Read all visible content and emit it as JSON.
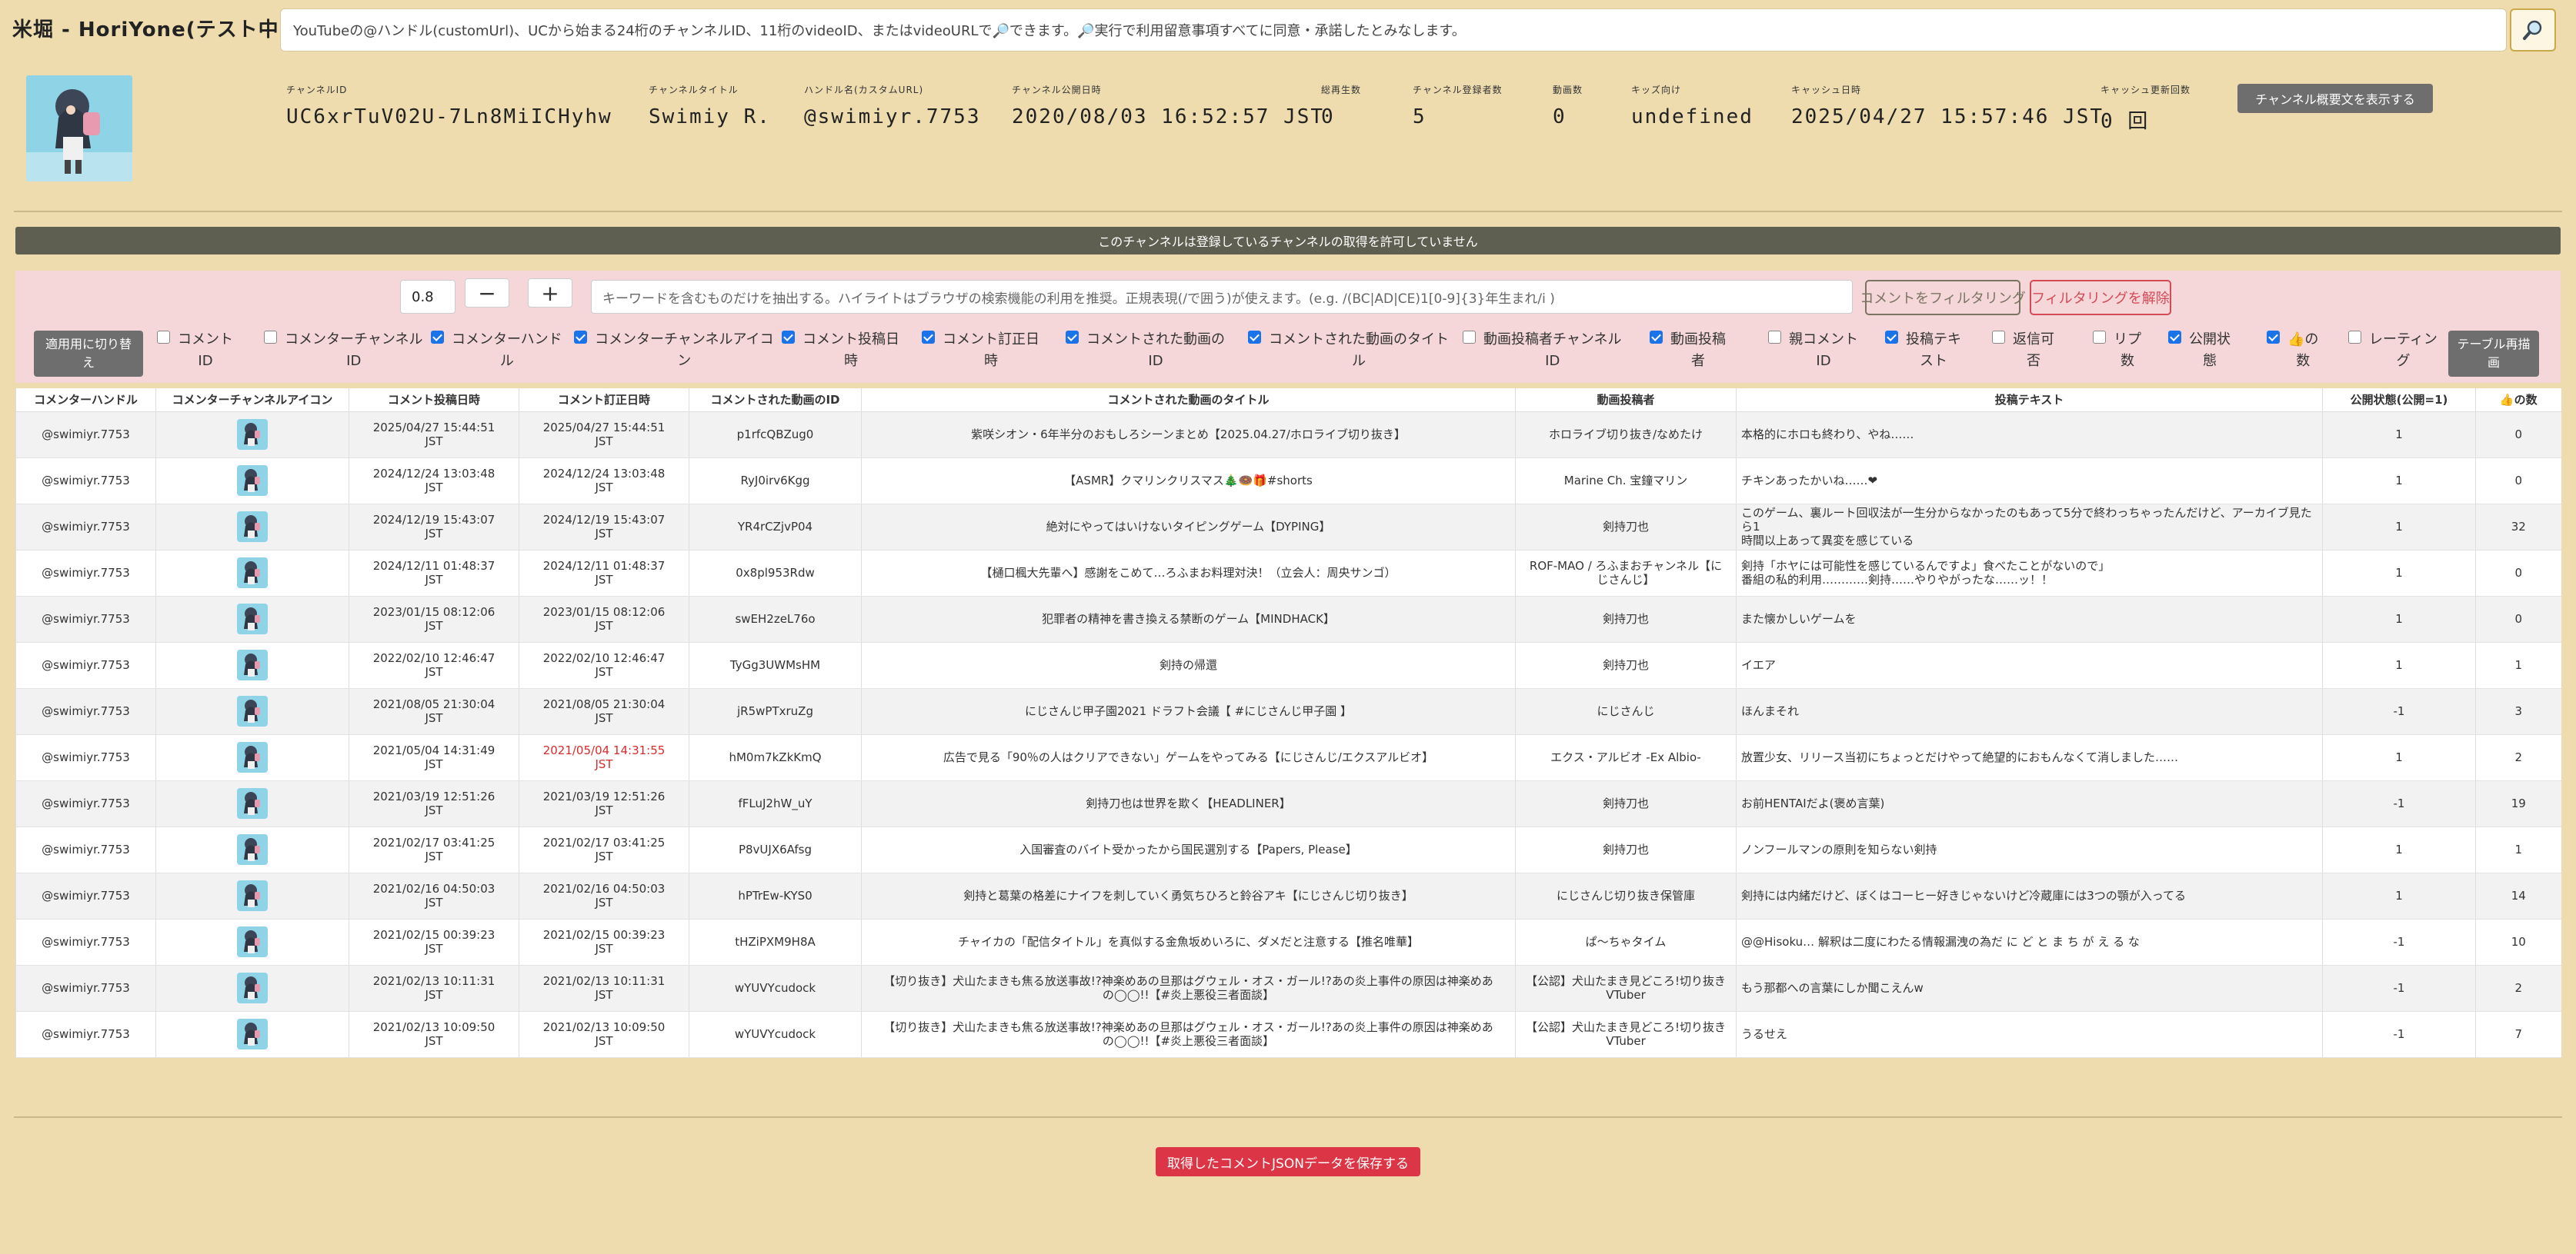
{
  "app": {
    "title": "米堀 - HoriYone(テスト中)"
  },
  "search": {
    "placeholder": "YouTubeの@ハンドル(customUrl)、UCから始まる24桁のチャンネルID、11桁のvideoID、またはvideoURLで🔎できます。🔎実行で利用留意事項すべてに同意・承諾したとみなします。",
    "button_icon": "search-icon"
  },
  "channel": {
    "fields": [
      {
        "label": "チャンネルID",
        "value": "UC6xrTuV02U-7Ln8MiICHyhw"
      },
      {
        "label": "チャンネルタイトル",
        "value": "Swimiy R."
      },
      {
        "label": "ハンドル名(カスタムURL)",
        "value": "@swimiyr.7753"
      },
      {
        "label": "チャンネル公開日時",
        "value": "2020/08/03 16:52:57 JST"
      },
      {
        "label": "総再生数",
        "value": "0"
      },
      {
        "label": "チャンネル登録者数",
        "value": "5"
      },
      {
        "label": "動画数",
        "value": "0"
      },
      {
        "label": "キッズ向け",
        "value": "undefined"
      },
      {
        "label": "キャッシュ日時",
        "value": "2025/04/27 15:57:46 JST"
      },
      {
        "label": "キャッシュ更新回数",
        "value": "0 回"
      }
    ],
    "desc_button": "チャンネル概要文を表示する"
  },
  "notice": "このチャンネルは登録しているチャンネルの取得を許可していません",
  "filter": {
    "zoom": "0.8",
    "minus_label": "−",
    "plus_label": "+",
    "keyword_placeholder": "キーワードを含むものだけを抽出する。ハイライトはブラウザの検索機能の利用を推奨。正規表現(/で囲う)が使えます。(e.g. /(BC|AD|CE)1[0-9]{3}年生まれ/i )",
    "filter_button": "コメントをフィルタリング",
    "clear_button": "フィルタリングを解除",
    "apply_toggle": [
      "適用用に切り替",
      "え"
    ],
    "redraw": [
      "テーブル再描",
      "画"
    ],
    "columns": [
      {
        "lines": [
          "コメント",
          "ID"
        ],
        "checked": false
      },
      {
        "lines": [
          "コメンターチャンネル",
          "ID"
        ],
        "checked": false
      },
      {
        "lines": [
          "コメンターハンド",
          "ル"
        ],
        "checked": true
      },
      {
        "lines": [
          "コメンターチャンネルアイコ",
          "ン"
        ],
        "checked": true
      },
      {
        "lines": [
          "コメント投稿日",
          "時"
        ],
        "checked": true
      },
      {
        "lines": [
          "コメント訂正日",
          "時"
        ],
        "checked": true
      },
      {
        "lines": [
          "コメントされた動画の",
          "ID"
        ],
        "checked": true
      },
      {
        "lines": [
          "コメントされた動画のタイト",
          "ル"
        ],
        "checked": true
      },
      {
        "lines": [
          "動画投稿者チャンネル",
          "ID"
        ],
        "checked": false
      },
      {
        "lines": [
          "動画投稿",
          "者"
        ],
        "checked": true
      },
      {
        "lines": [
          "親コメント",
          "ID"
        ],
        "checked": false
      },
      {
        "lines": [
          "投稿テキ",
          "スト"
        ],
        "checked": true
      },
      {
        "lines": [
          "返信可",
          "否"
        ],
        "checked": false
      },
      {
        "lines": [
          "リプ",
          "数"
        ],
        "checked": false
      },
      {
        "lines": [
          "公開状",
          "態"
        ],
        "checked": true
      },
      {
        "lines": [
          "👍の",
          "数"
        ],
        "checked": true
      },
      {
        "lines": [
          "レーティン",
          "グ"
        ],
        "checked": false
      }
    ]
  },
  "table": {
    "headers": [
      "コメンターハンドル",
      "コメンターチャンネルアイコン",
      "コメント投稿日時",
      "コメント訂正日時",
      "コメントされた動画のID",
      "コメントされた動画のタイトル",
      "動画投稿者",
      "投稿テキスト",
      "公開状態(公開=1)",
      "👍の数"
    ],
    "rows": [
      {
        "handle": "@swimiyr.7753",
        "posted": [
          "2025/04/27 15:44:51",
          "JST"
        ],
        "edited": [
          "2025/04/27 15:44:51",
          "JST"
        ],
        "edited_red": false,
        "video_id": "p1rfcQBZug0",
        "title": [
          "紫咲シオン・6年半分のおもしろシーンまとめ【2025.04.27/ホロライブ切り抜き】"
        ],
        "uploader": [
          "ホロライブ切り抜き/なめたけ"
        ],
        "text": [
          "本格的にホロも終わり、やね……"
        ],
        "public": "1",
        "likes": "0"
      },
      {
        "handle": "@swimiyr.7753",
        "posted": [
          "2024/12/24 13:03:48",
          "JST"
        ],
        "edited": [
          "2024/12/24 13:03:48",
          "JST"
        ],
        "edited_red": false,
        "video_id": "RyJ0irv6Kgg",
        "title": [
          "【ASMR】クマリンクリスマス🎄🍩🎁#shorts"
        ],
        "uploader": [
          "Marine Ch. 宝鐘マリン"
        ],
        "text": [
          "チキンあったかいね……❤"
        ],
        "public": "1",
        "likes": "0"
      },
      {
        "handle": "@swimiyr.7753",
        "posted": [
          "2024/12/19 15:43:07",
          "JST"
        ],
        "edited": [
          "2024/12/19 15:43:07",
          "JST"
        ],
        "edited_red": false,
        "video_id": "YR4rCZjvP04",
        "title": [
          "絶対にやってはいけないタイピングゲーム【DYPING】"
        ],
        "uploader": [
          "剣持刀也"
        ],
        "text": [
          "このゲーム、裏ルート回収法が一生分からなかったのもあって5分で終わっちゃったんだけど、アーカイブ見たら1",
          "時間以上あって異変を感じている"
        ],
        "public": "1",
        "likes": "32"
      },
      {
        "handle": "@swimiyr.7753",
        "posted": [
          "2024/12/11 01:48:37",
          "JST"
        ],
        "edited": [
          "2024/12/11 01:48:37",
          "JST"
        ],
        "edited_red": false,
        "video_id": "0x8pl953Rdw",
        "title": [
          "【樋口楓大先輩へ】感謝をこめて…ろふまお料理対決！（立会人：周央サンゴ）"
        ],
        "uploader": [
          "ROF-MAO / ろふまおチャンネル【に",
          "じさんじ】"
        ],
        "text": [
          "剣持「ホヤには可能性を感じているんですよ」食べたことがないので」",
          "番組の私的利用…………剣持……やりやがったな……ッ！！"
        ],
        "public": "1",
        "likes": "0"
      },
      {
        "handle": "@swimiyr.7753",
        "posted": [
          "2023/01/15 08:12:06",
          "JST"
        ],
        "edited": [
          "2023/01/15 08:12:06",
          "JST"
        ],
        "edited_red": false,
        "video_id": "swEH2zeL76o",
        "title": [
          "犯罪者の精神を書き換える禁断のゲーム【MINDHACK】"
        ],
        "uploader": [
          "剣持刀也"
        ],
        "text": [
          "また懐かしいゲームを"
        ],
        "public": "1",
        "likes": "0"
      },
      {
        "handle": "@swimiyr.7753",
        "posted": [
          "2022/02/10 12:46:47",
          "JST"
        ],
        "edited": [
          "2022/02/10 12:46:47",
          "JST"
        ],
        "edited_red": false,
        "video_id": "TyGg3UWMsHM",
        "title": [
          "剣持の帰還"
        ],
        "uploader": [
          "剣持刀也"
        ],
        "text": [
          "イエア"
        ],
        "public": "1",
        "likes": "1"
      },
      {
        "handle": "@swimiyr.7753",
        "posted": [
          "2021/08/05 21:30:04",
          "JST"
        ],
        "edited": [
          "2021/08/05 21:30:04",
          "JST"
        ],
        "edited_red": false,
        "video_id": "jR5wPTxruZg",
        "title": [
          "にじさんじ甲子園2021 ドラフト会議【 #にじさんじ甲子園 】"
        ],
        "uploader": [
          "にじさんじ"
        ],
        "text": [
          "ほんまそれ"
        ],
        "public": "-1",
        "likes": "3"
      },
      {
        "handle": "@swimiyr.7753",
        "posted": [
          "2021/05/04 14:31:49",
          "JST"
        ],
        "edited": [
          "2021/05/04 14:31:55",
          "JST"
        ],
        "edited_red": true,
        "video_id": "hM0m7kZkKmQ",
        "title": [
          "広告で見る「90％の人はクリアできない」ゲームをやってみる【にじさんじ/エクスアルビオ】"
        ],
        "uploader": [
          "エクス・アルビオ -Ex Albio-"
        ],
        "text": [
          "放置少女、リリース当初にちょっとだけやって絶望的におもんなくて消しました……"
        ],
        "public": "1",
        "likes": "2"
      },
      {
        "handle": "@swimiyr.7753",
        "posted": [
          "2021/03/19 12:51:26",
          "JST"
        ],
        "edited": [
          "2021/03/19 12:51:26",
          "JST"
        ],
        "edited_red": false,
        "video_id": "fFLuJ2hW_uY",
        "title": [
          "剣持刀也は世界を欺く【HEADLINER】"
        ],
        "uploader": [
          "剣持刀也"
        ],
        "text": [
          "お前HENTAIだよ(褒め言葉)"
        ],
        "public": "-1",
        "likes": "19"
      },
      {
        "handle": "@swimiyr.7753",
        "posted": [
          "2021/02/17 03:41:25",
          "JST"
        ],
        "edited": [
          "2021/02/17 03:41:25",
          "JST"
        ],
        "edited_red": false,
        "video_id": "P8vUJX6Afsg",
        "title": [
          "入国審査のバイト受かったから国民選別する【Papers, Please】"
        ],
        "uploader": [
          "剣持刀也"
        ],
        "text": [
          "ノンフールマンの原則を知らない剣持"
        ],
        "public": "1",
        "likes": "1"
      },
      {
        "handle": "@swimiyr.7753",
        "posted": [
          "2021/02/16 04:50:03",
          "JST"
        ],
        "edited": [
          "2021/02/16 04:50:03",
          "JST"
        ],
        "edited_red": false,
        "video_id": "hPTrEw-KYS0",
        "title": [
          "剣持と葛葉の格差にナイフを刺していく勇気ちひろと鈴谷アキ【にじさんじ切り抜き】"
        ],
        "uploader": [
          "にじさんじ切り抜き保管庫"
        ],
        "text": [
          "剣持には内緒だけど、ぼくはコーヒー好きじゃないけど冷蔵庫には3つの顎が入ってる"
        ],
        "public": "1",
        "likes": "14"
      },
      {
        "handle": "@swimiyr.7753",
        "posted": [
          "2021/02/15 00:39:23",
          "JST"
        ],
        "edited": [
          "2021/02/15 00:39:23",
          "JST"
        ],
        "edited_red": false,
        "video_id": "tHZiPXM9H8A",
        "title": [
          "チャイカの「配信タイトル」を真似する金魚坂めいろに、ダメだと注意する【推名唯華】"
        ],
        "uploader": [
          "ぱ～ちゃタイム"
        ],
        "text": [
          "@@Hisoku… 解釈は二度にわたる情報漏洩の為だ に ど と ま ち が え る な"
        ],
        "public": "-1",
        "likes": "10"
      },
      {
        "handle": "@swimiyr.7753",
        "posted": [
          "2021/02/13 10:11:31",
          "JST"
        ],
        "edited": [
          "2021/02/13 10:11:31",
          "JST"
        ],
        "edited_red": false,
        "video_id": "wYUVYcudock",
        "title": [
          "【切り抜き】犬山たまきも焦る放送事故!?神楽めあの旦那はグウェル・オス・ガール!?あの炎上事件の原因は神楽めあ",
          "の◯◯!!【#炎上悪役三者面談】"
        ],
        "uploader": [
          "【公認】犬山たまき見どころ!切り抜き",
          "VTuber"
        ],
        "text": [
          "もう那都への言葉にしか聞こえんw"
        ],
        "public": "-1",
        "likes": "2"
      },
      {
        "handle": "@swimiyr.7753",
        "posted": [
          "2021/02/13 10:09:50",
          "JST"
        ],
        "edited": [
          "2021/02/13 10:09:50",
          "JST"
        ],
        "edited_red": false,
        "video_id": "wYUVYcudock",
        "title": [
          "【切り抜き】犬山たまきも焦る放送事故!?神楽めあの旦那はグウェル・オス・ガール!?あの炎上事件の原因は神楽めあ",
          "の◯◯!!【#炎上悪役三者面談】"
        ],
        "uploader": [
          "【公認】犬山たまき見どころ!切り抜き",
          "VTuber"
        ],
        "text": [
          "うるせえ"
        ],
        "public": "-1",
        "likes": "7"
      }
    ]
  },
  "save_button": "取得したコメントJSONデータを保存する",
  "colors": {
    "background": "#eedcaf",
    "panel": "#f5d7d9",
    "accent_red": "#dc3545",
    "notice": "#5f5f51",
    "checkbox": "#1a73e8"
  }
}
